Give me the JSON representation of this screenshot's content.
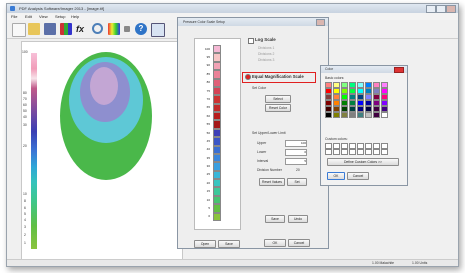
{
  "window": {
    "title": "PDF Analysis Software/Imager 2013 - [image.tif]"
  },
  "menubar": [
    "File",
    "Edit",
    "View",
    "Setup",
    "Help"
  ],
  "toolbar_icons": [
    "new-document-icon",
    "open-folder-icon",
    "save-icon",
    "histogram-icon",
    "formula-icon",
    "magnifier-icon",
    "color-palette-icon",
    "measure-icon",
    "help-icon",
    "info-icon"
  ],
  "left_scale": {
    "top_label": "100",
    "upper_labels": [
      "80",
      "70",
      "60",
      "50",
      "40",
      "30",
      "20"
    ],
    "lower_labels": [
      "10",
      "8",
      "6",
      "5",
      "4",
      "3",
      "2",
      "1"
    ]
  },
  "scale_dialog": {
    "title": "Pressure Color Scale Setup",
    "scale_labels": [
      "100",
      "95",
      "90",
      "85",
      "80",
      "75",
      "70",
      "65",
      "60",
      "55",
      "50",
      "45",
      "40",
      "35",
      "30",
      "25",
      "20",
      "15",
      "10",
      "5",
      "0"
    ],
    "log_scale_label": "Log Scale",
    "log_options": [
      "Divisions 1",
      "Divisions 2",
      "Divisions 3"
    ],
    "equal_mag_label": "Equal Magnification Scale",
    "set_color_label": "Set Color",
    "select_label": "Select",
    "reset_color_label": "Reset Color",
    "limit_group_label": "Set Upper/Lower Limit",
    "upper_label": "Upper",
    "upper_value": "100",
    "lower_label": "Lower",
    "lower_value": "0",
    "interval_label": "Interval",
    "interval_value": "5",
    "divisions_label": "Division Number",
    "divisions_value": "20",
    "reset_values_label": "Reset Values",
    "set_label": "Set",
    "save_label": "Save",
    "undo_label": "Undo",
    "left_btn1": "Open",
    "left_btn2": "Save",
    "ok_label": "OK",
    "cancel_label": "Cancel"
  },
  "color_dialog": {
    "title": "Color",
    "basic_colors_label": "Basic colors:",
    "custom_colors_label": "Custom colors:",
    "define_label": "Define Custom Colors >>",
    "ok_label": "OK",
    "cancel_label": "Cancel"
  },
  "status": {
    "left": "1.00 Malachite",
    "right": "1.00 Units"
  },
  "colors": {
    "scale": [
      "#f5b8d4",
      "#f7c6c6",
      "#f2a2b5",
      "#ea8298",
      "#e06078",
      "#d54356",
      "#cc3333",
      "#c22a2a",
      "#b71d1d",
      "#a41818",
      "#3d3fb7",
      "#3b56c7",
      "#3a6fd3",
      "#3a86dc",
      "#3a9fe0",
      "#3ab6d8",
      "#38c5c0",
      "#3cc89a",
      "#46c471",
      "#62c043",
      "#8bc33d"
    ],
    "basic": [
      "#ff8080",
      "#ffff80",
      "#80ff80",
      "#00ff80",
      "#80ffff",
      "#0080ff",
      "#ff80c0",
      "#ff80ff",
      "#ff0000",
      "#ffff00",
      "#80ff00",
      "#00ff40",
      "#00ffff",
      "#0080c0",
      "#8080c0",
      "#ff00ff",
      "#804040",
      "#ff8040",
      "#00ff00",
      "#008080",
      "#004080",
      "#8080ff",
      "#800040",
      "#ff0080",
      "#800000",
      "#ff8000",
      "#008000",
      "#008040",
      "#0000ff",
      "#0000a0",
      "#800080",
      "#8000ff",
      "#400000",
      "#804000",
      "#004000",
      "#004040",
      "#000080",
      "#000040",
      "#400040",
      "#400080",
      "#000000",
      "#808000",
      "#808040",
      "#808080",
      "#408080",
      "#c0c0c0",
      "#400040",
      "#ffffff"
    ]
  }
}
